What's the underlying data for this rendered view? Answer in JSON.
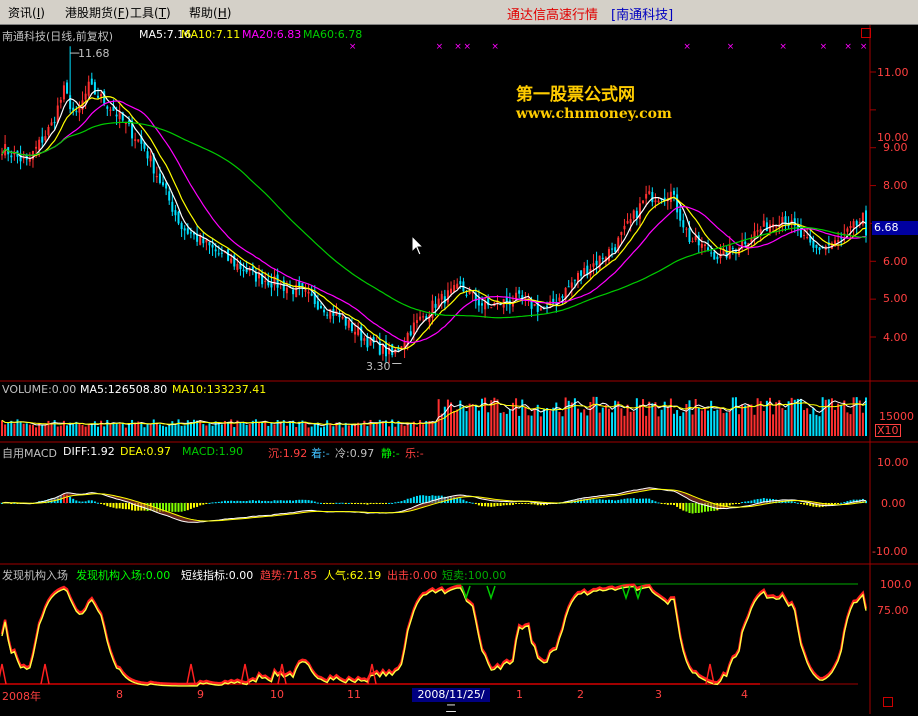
{
  "menu": {
    "items": [
      "资讯",
      "港股期货",
      "工具",
      "帮助"
    ],
    "underlined_keys": [
      "I",
      "F",
      "T",
      "H"
    ]
  },
  "window": {
    "title": "通达信高速行情",
    "stock_tag": "[南通科技]"
  },
  "price_panel": {
    "header": {
      "name": "南通科技(日线,前复权)",
      "ma5": "MA5:7.16",
      "ma10": "MA10:7.11",
      "ma20": "MA20:6.83",
      "ma60": "MA60:6.78"
    },
    "high_label": "11.68",
    "low_label": "3.30",
    "current_price": "6.68",
    "watermark_cn": "第一股票公式网",
    "watermark_url": "www.chnmoney.com",
    "y_ticks": [
      "11.00",
      "10.00",
      "9.00",
      "8.00",
      "7.00",
      "6.00",
      "5.00",
      "4.00"
    ],
    "colors": {
      "ma5": "#ffffff",
      "ma10": "#ffff00",
      "ma20": "#ff00ff",
      "ma60": "#00cc00",
      "up": "#ff3030",
      "down": "#00e0ff"
    }
  },
  "volume_panel": {
    "header": {
      "vol": "VOLUME:0.00",
      "ma5": "MA5:126508.80",
      "ma10": "MA10:133237.41"
    },
    "tick": "15000",
    "unit": "X10"
  },
  "macd_panel": {
    "header": {
      "name": "自用MACD",
      "diff": "DIFF:1.92",
      "dea": "DEA:0.97",
      "macd": "MACD:1.90",
      "chen": "沉:1.92",
      "zhao": "着:-",
      "leng": "冷:0.97",
      "jing": "静:-",
      "le": "乐:-"
    },
    "y_ticks": [
      "10.00",
      "0.00",
      "-10.00"
    ]
  },
  "indicator_panel": {
    "header": {
      "name": "发现机构入场",
      "jigou": "发现机构入场:0.00",
      "duanxian": "短线指标:0.00",
      "qushi": "趋势:71.85",
      "renqi": "人气:62.19",
      "chuji": "出击:0.00",
      "duanmai": "短卖:100.00"
    },
    "y_ticks": [
      "100.0",
      "75.00"
    ]
  },
  "date_axis": {
    "labels": [
      "2008年",
      "8",
      "9",
      "10",
      "11",
      "1",
      "2",
      "3",
      "4"
    ],
    "cursor_date": "2008/11/25/二"
  },
  "chart_data": {
    "type": "candlestick",
    "title": "南通科技(日线,前复权)",
    "price_range": [
      3.3,
      11.68
    ],
    "ylim": [
      3.3,
      11.9
    ],
    "last_close": 6.68,
    "moving_averages": {
      "MA5": 7.16,
      "MA10": 7.11,
      "MA20": 6.83,
      "MA60": 6.78
    },
    "key_points": [
      {
        "label": "high",
        "value": 11.68
      },
      {
        "label": "low",
        "value": 3.3
      }
    ],
    "macd": {
      "DIFF": 1.92,
      "DEA": 0.97,
      "MACD": 1.9,
      "ylim": [
        -13,
        13
      ]
    },
    "volume": {
      "MA5": 126508.8,
      "MA10": 133237.41,
      "unit_multiplier": 10
    },
    "indicator": {
      "趋势": 71.85,
      "人气": 62.19,
      "出击": 0.0,
      "短卖": 100.0,
      "ylim": [
        0,
        110
      ]
    }
  }
}
